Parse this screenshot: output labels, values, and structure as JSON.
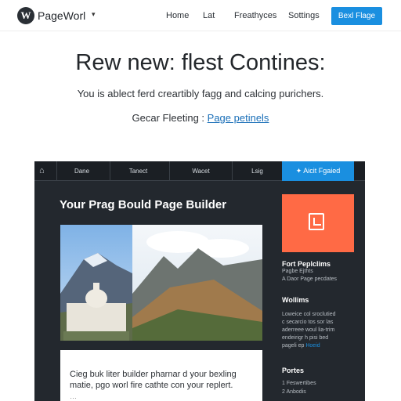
{
  "topbar": {
    "logo_letter": "W",
    "brand": "PageWorl",
    "nav": [
      "Home",
      "Lat",
      "Freathyces",
      "Sottings"
    ],
    "cta": "Bexl Flage"
  },
  "hero": {
    "title": "Rew new: flest Contines:",
    "subtitle": "You is ablect ferd creartibly fagg and calcing purichers.",
    "link_prefix": "Gecar Fleeting : ",
    "link_text": "Page petinels"
  },
  "builder": {
    "tabs": [
      "Dane",
      "Tanect",
      "Wacet",
      "Lsig"
    ],
    "active_tab": "Aicit Fgaied",
    "canvas_title": "Your Prag Bould Page Builder",
    "text_card": {
      "line1": "Cieg buk liter builder pharnar d your bexling",
      "line2": "matie, pgo worl fire cathte con your replert.",
      "more": "…"
    },
    "sidebar": {
      "accent_color": "#ff6a45",
      "icon": "document-icon",
      "section1_title": "Fort Peplclims",
      "section1_lines": [
        "Pagbe Ejthts",
        "A Daor Page pecdates"
      ],
      "section2_title": "Wollims",
      "section2_lines": [
        "Loweice col sroclutied",
        "c secarcio tos sor las",
        "aderreee woul lia-trim",
        "endeirigr h pisi bed",
        "pageli ep Hoeid"
      ],
      "section2_highlight": "Hoeid",
      "section3_title": "Portes",
      "section3_lines": [
        "1 Feswertibes",
        "2 Anbodis"
      ]
    }
  },
  "colors": {
    "cta_blue": "#1a8fe0",
    "builder_bg": "#23282e",
    "accent_orange": "#ff6a45"
  }
}
